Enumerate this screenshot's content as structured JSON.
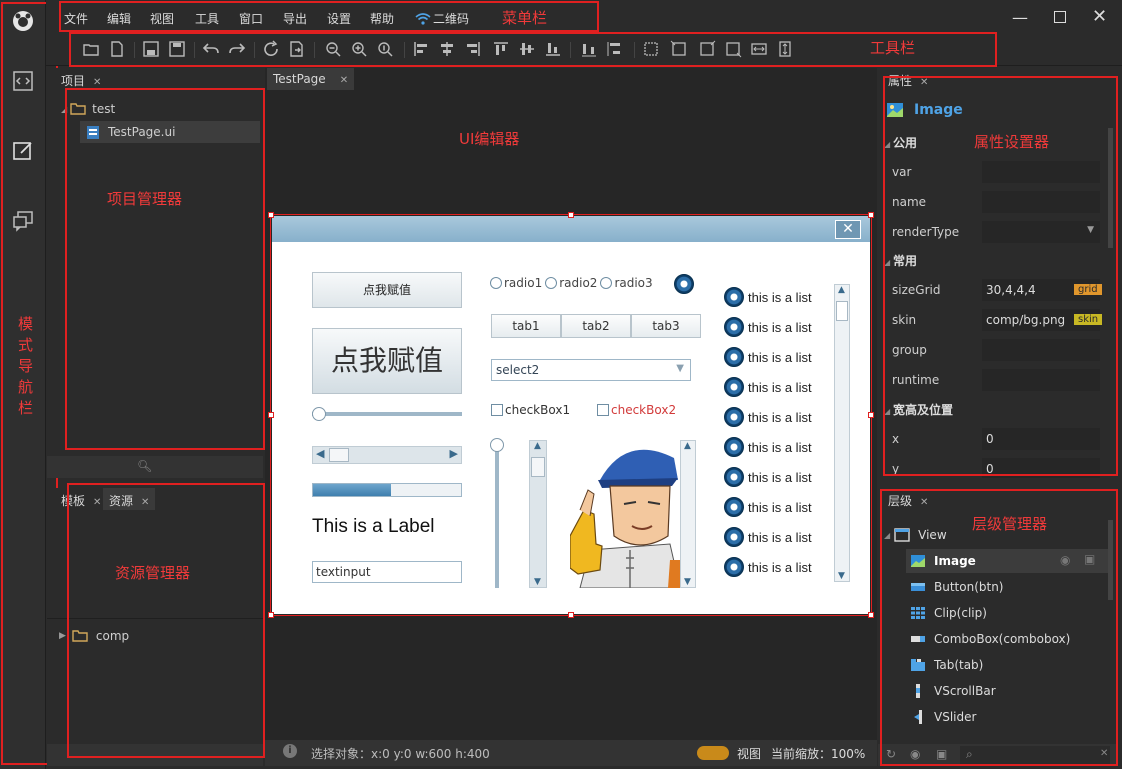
{
  "menu": {
    "items": [
      "文件",
      "编辑",
      "视图",
      "工具",
      "窗口",
      "导出",
      "设置",
      "帮助"
    ],
    "qrcode_label": "二维码",
    "annotation": "菜单栏"
  },
  "toolbar": {
    "annotation": "工具栏"
  },
  "nav": {
    "annotation": "模式导航栏"
  },
  "project_panel": {
    "tab_label": "项目",
    "annotation": "项目管理器",
    "tree": {
      "root": "test",
      "child": "TestPage.ui"
    }
  },
  "resource_panel": {
    "tabs": [
      "模板",
      "资源"
    ],
    "annotation": "资源管理器",
    "folder": "comp"
  },
  "editor": {
    "tab_label": "TestPage",
    "annotation": "UI编辑器",
    "status": "选择对象：x:0 y:0  w:600 h:400",
    "view_label": "视图",
    "zoom_label": "当前缩放：100%"
  },
  "canvas": {
    "button_small": "点我赋值",
    "button_large": "点我赋值",
    "radios": [
      "radio1",
      "radio2",
      "radio3"
    ],
    "tabs": [
      "tab1",
      "tab2",
      "tab3"
    ],
    "combo_value": "select2",
    "checkboxes": [
      "checkBox1",
      "checkBox2"
    ],
    "label": "This is a Label",
    "textinput": "textinput",
    "progress": 0.53,
    "list_items": [
      "this is a list",
      "this is a list",
      "this is a list",
      "this is a list",
      "this is a list",
      "this is a list",
      "this is a list",
      "this is a list",
      "this is a list",
      "this is a list"
    ]
  },
  "props_panel": {
    "tab_label": "属性",
    "annotation": "属性设置器",
    "selected": "Image",
    "sections": {
      "common": "公用",
      "usual": "常用",
      "size_pos": "宽高及位置"
    },
    "fields": {
      "var": "var",
      "name": "name",
      "renderType": "renderType",
      "sizeGrid": "sizeGrid",
      "sizeGrid_value": "30,4,4,4",
      "sizeGrid_tag": "grid",
      "skin": "skin",
      "skin_value": "comp/bg.png",
      "skin_tag": "skin",
      "group": "group",
      "runtime": "runtime",
      "x": "x",
      "x_value": "0",
      "y": "y",
      "y_value": "0"
    },
    "colors": {
      "grid_tag": "#e0962c",
      "skin_tag": "#c8b824",
      "accent": "#4fa3e6"
    }
  },
  "layers_panel": {
    "tab_label": "层级",
    "annotation": "层级管理器",
    "root": "View",
    "items": [
      "Image",
      "Button(btn)",
      "Clip(clip)",
      "ComboBox(combobox)",
      "Tab(tab)",
      "VScrollBar",
      "VSlider"
    ]
  }
}
